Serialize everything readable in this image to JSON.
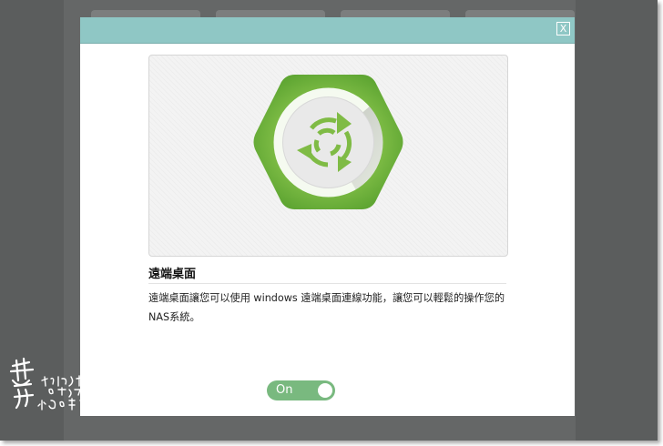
{
  "dialog": {
    "close_label": "X"
  },
  "app": {
    "title": "遠端桌面",
    "description": "遠端桌面讓您可以使用 windows 遠端桌面連線功能，讓您可以輕鬆的操作您的NAS系統。",
    "icon": "remote-desktop-icon"
  },
  "toggle": {
    "label": "On",
    "state": "on"
  },
  "watermark": {
    "line1": "まじちゃんのブログ",
    "line2": "小梟の部落格"
  },
  "colors": {
    "header": "#8fc7c5",
    "toggle_on": "#79b97f",
    "icon_green": "#6fb43a",
    "backdrop": "#5b5d5d"
  }
}
